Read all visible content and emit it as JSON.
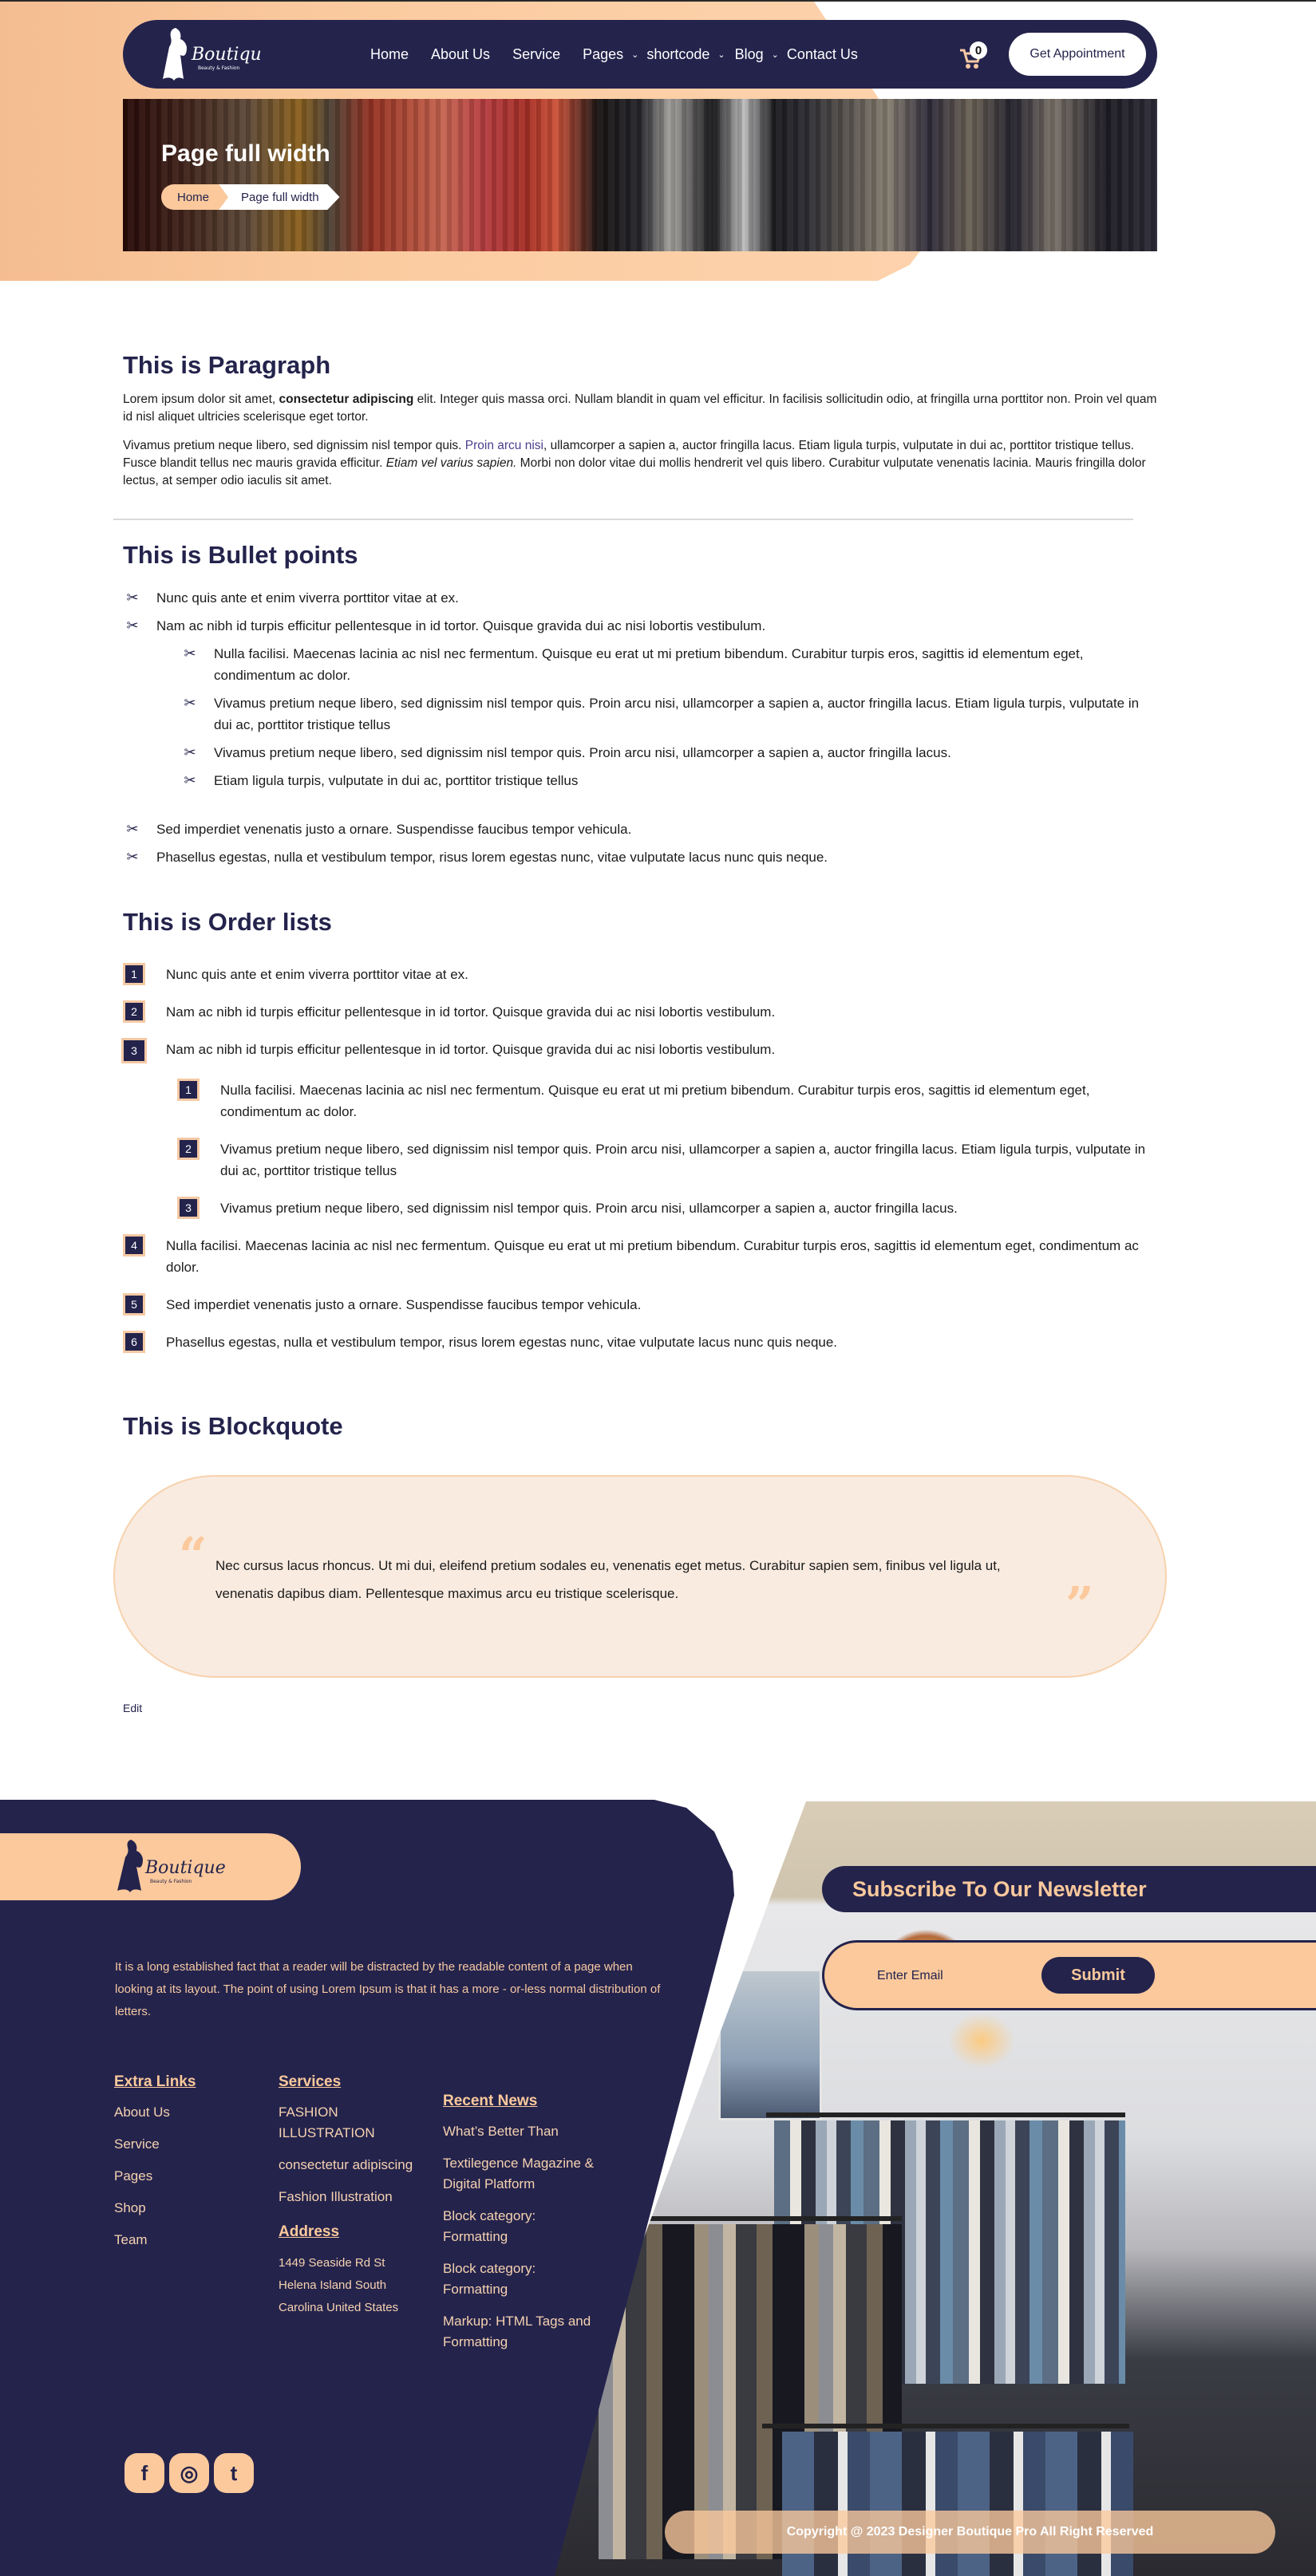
{
  "header": {
    "logo_text": "Boutique",
    "logo_tagline": "Beauty & Fashion",
    "nav": [
      {
        "label": "Home",
        "dropdown": false
      },
      {
        "label": "About Us",
        "dropdown": false
      },
      {
        "label": "Service",
        "dropdown": false
      },
      {
        "label": "Pages",
        "dropdown": true
      },
      {
        "label": "shortcode",
        "dropdown": true
      },
      {
        "label": "Blog",
        "dropdown": true
      },
      {
        "label": "Contact Us",
        "dropdown": false
      }
    ],
    "cart_icon": "shopping-cart-icon",
    "cart_count": "0",
    "cta_label": "Get Appointment"
  },
  "banner": {
    "title": "Page full width",
    "breadcrumb": [
      "Home",
      "Page full width"
    ]
  },
  "paragraph_section": {
    "title": "This is Paragraph",
    "p1": {
      "before": "Lorem ipsum dolor sit amet, ",
      "bold": "consectetur adipiscing",
      "after": " elit. Integer quis massa orci. Nullam blandit in quam vel efficitur. In facilisis sollicitudin odio, at fringilla urna porttitor non. Proin vel quam id nisl aliquet ultricies scelerisque eget tortor."
    },
    "p2": {
      "before": "Vivamus pretium neque libero, sed dignissim nisl tempor quis. ",
      "link": "Proin arcu nisi",
      "middle": ", ullamcorper a sapien a, auctor fringilla lacus. Etiam ligula turpis, vulputate in dui ac, porttitor tristique tellus. Fusce blandit tellus nec mauris gravida efficitur. ",
      "italic": "Etiam vel varius sapien.",
      "after": " Morbi non dolor vitae dui mollis hendrerit vel quis libero. Curabitur vulputate venenatis lacinia. Mauris fringilla dolor lectus, at semper odio iaculis sit amet."
    }
  },
  "bullet_section": {
    "title": "This is Bullet points",
    "icon": "scissors-icon",
    "items_top": [
      "Nunc quis ante et enim viverra porttitor vitae at ex.",
      "Nam ac nibh id turpis efficitur pellentesque in id tortor. Quisque gravida dui ac nisi lobortis vestibulum."
    ],
    "items_nested": [
      "Nulla facilisi. Maecenas lacinia ac nisl nec fermentum. Quisque eu erat ut mi pretium bibendum. Curabitur turpis eros, sagittis id elementum eget, condimentum ac dolor.",
      "Vivamus pretium neque libero, sed dignissim nisl tempor quis. Proin arcu nisi, ullamcorper a sapien a, auctor fringilla lacus. Etiam ligula turpis, vulputate in dui ac, porttitor tristique tellus",
      "Vivamus pretium neque libero, sed dignissim nisl tempor quis. Proin arcu nisi, ullamcorper a sapien a, auctor fringilla lacus.",
      "Etiam ligula turpis, vulputate in dui ac, porttitor tristique tellus"
    ],
    "items_bottom": [
      "Sed imperdiet venenatis justo a ornare. Suspendisse faucibus tempor vehicula.",
      "Phasellus egestas, nulla et vestibulum tempor, risus lorem egestas nunc, vitae vulputate lacus nunc quis neque."
    ]
  },
  "order_section": {
    "title": "This is Order lists",
    "items_top": [
      {
        "num": "1",
        "text": "Nunc quis ante et enim viverra porttitor vitae at ex."
      },
      {
        "num": "2",
        "text": "Nam ac nibh id turpis efficitur pellentesque in id tortor. Quisque gravida dui ac nisi lobortis vestibulum."
      },
      {
        "num": "3",
        "text": "Nam ac nibh id turpis efficitur pellentesque in id tortor. Quisque gravida dui ac nisi lobortis vestibulum."
      }
    ],
    "items_nested": [
      {
        "num": "1",
        "text": "Nulla facilisi. Maecenas lacinia ac nisl nec fermentum. Quisque eu erat ut mi pretium bibendum. Curabitur turpis eros, sagittis id elementum eget, condimentum ac dolor."
      },
      {
        "num": "2",
        "text": "Vivamus pretium neque libero, sed dignissim nisl tempor quis. Proin arcu nisi, ullamcorper a sapien a, auctor fringilla lacus. Etiam ligula turpis, vulputate in dui ac, porttitor tristique tellus"
      },
      {
        "num": "3",
        "text": "Vivamus pretium neque libero, sed dignissim nisl tempor quis. Proin arcu nisi, ullamcorper a sapien a, auctor fringilla lacus."
      }
    ],
    "items_bottom": [
      {
        "num": "4",
        "text": "Nulla facilisi. Maecenas lacinia ac nisl nec fermentum. Quisque eu erat ut mi pretium bibendum. Curabitur turpis eros, sagittis id elementum eget, condimentum ac dolor."
      },
      {
        "num": "5",
        "text": "Sed imperdiet venenatis justo a ornare. Suspendisse faucibus tempor vehicula."
      },
      {
        "num": "6",
        "text": "Phasellus egestas, nulla et vestibulum tempor, risus lorem egestas nunc, vitae vulputate lacus nunc quis neque."
      }
    ]
  },
  "blockquote_section": {
    "title": "This is Blockquote",
    "open_mark": "“",
    "close_mark": "”",
    "text": "Nec cursus lacus rhoncus. Ut mi dui, eleifend pretium sodales eu, venenatis eget metus. Curabitur sapien sem, finibus vel ligula ut, venenatis dapibus diam. Pellentesque maximus arcu eu tristique scelerisque."
  },
  "edit_link": "Edit",
  "footer": {
    "logo_text": "Boutique",
    "logo_tagline": "Beauty & Fashion",
    "about": "It is a long established fact that a reader will be distracted by the readable content of a page when looking at its layout. The point of using Lorem Ipsum is that it has a more - or-less normal distribution of letters.",
    "extra_links": {
      "title": "Extra Links",
      "items": [
        "About Us",
        "Service",
        "Pages",
        "Shop",
        "Team"
      ]
    },
    "services": {
      "title": "Services",
      "items": [
        "FASHION ILLUSTRATION",
        "consectetur adipiscing",
        "Fashion Illustration"
      ]
    },
    "address": {
      "title": "Address",
      "lines": [
        "1449 Seaside Rd St",
        "Helena Island South",
        "Carolina United States"
      ]
    },
    "recent_news": {
      "title": "Recent News",
      "items": [
        "What’s Better Than",
        "Textilegence Magazine & Digital Platform",
        "Block category: Formatting",
        "Block category: Formatting",
        "Markup: HTML Tags and Formatting"
      ]
    },
    "social": [
      {
        "icon": "facebook-icon",
        "glyph": "f"
      },
      {
        "icon": "instagram-icon",
        "glyph": "◎"
      },
      {
        "icon": "twitter-icon",
        "glyph": "t"
      }
    ],
    "newsletter": {
      "title": "Subscribe To Our Newsletter",
      "placeholder": "Enter Email",
      "value": "",
      "submit_label": "Submit"
    },
    "copyright": "Copyright @ 2023 Designer Boutique Pro All Right Reserved"
  },
  "colors": {
    "navy": "#24234c",
    "peach": "#fbc99c",
    "blockquote_bg": "#f9ebe0"
  }
}
